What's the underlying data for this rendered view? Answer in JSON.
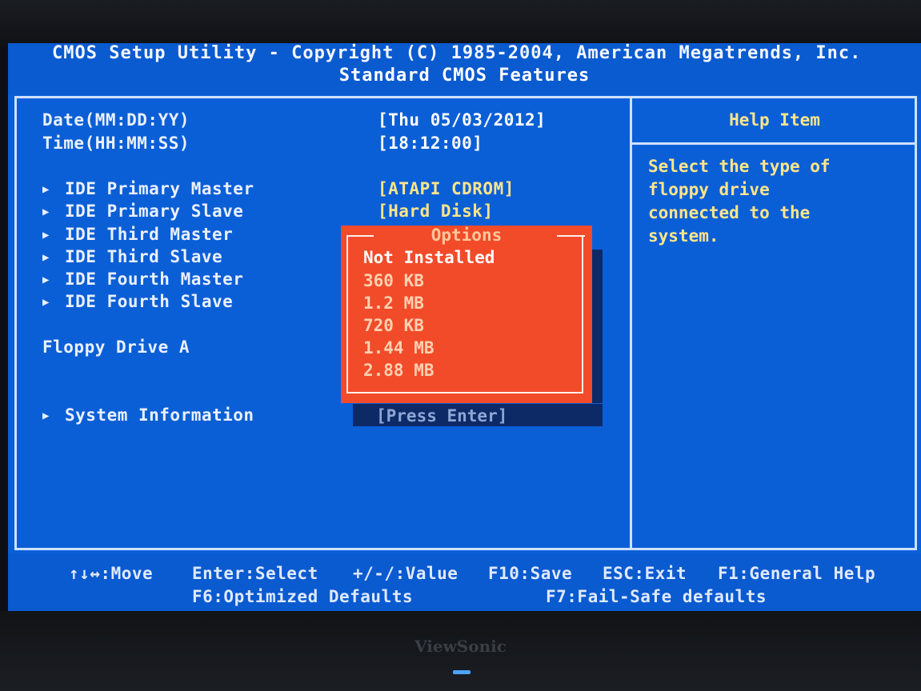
{
  "header": {
    "title": "CMOS Setup Utility - Copyright (C) 1985-2004, American Megatrends, Inc.",
    "subtitle": "Standard CMOS Features"
  },
  "settings": {
    "date": {
      "label": "Date(MM:DD:YY)",
      "value": "[Thu 05/03/2012]"
    },
    "time": {
      "label": "Time(HH:MM:SS)",
      "value": "[18:12:00]"
    },
    "ide": [
      {
        "label": "IDE Primary Master",
        "value": "[ATAPI CDROM]"
      },
      {
        "label": "IDE Primary Slave",
        "value": "[Hard Disk]"
      },
      {
        "label": "IDE Third Master",
        "value": ""
      },
      {
        "label": "IDE Third Slave",
        "value": ""
      },
      {
        "label": "IDE Fourth Master",
        "value": ""
      },
      {
        "label": "IDE Fourth Slave",
        "value": ""
      }
    ],
    "floppy": {
      "label": "Floppy Drive A"
    },
    "system_info": {
      "label": "System Information",
      "value": "[Press Enter]"
    }
  },
  "help": {
    "title": "Help Item",
    "text": "Select the type of\nfloppy drive\nconnected to the\nsystem."
  },
  "options_popup": {
    "title": "Options",
    "items": [
      "Not Installed",
      "360 KB",
      "1.2 MB",
      "720 KB",
      "1.44 MB",
      "2.88 MB"
    ],
    "selected": "Not Installed"
  },
  "footer": {
    "move": "↑↓↔:Move",
    "select": "Enter:Select",
    "value": "+/-/:Value",
    "save": "F10:Save",
    "exit": "ESC:Exit",
    "help": "F1:General Help",
    "optimized": "F6:Optimized Defaults",
    "failsafe": "F7:Fail-Safe defaults"
  },
  "monitor": {
    "brand": "ViewSonic"
  },
  "colors": {
    "background": "#0b5fd6",
    "popup": "#f24b2a",
    "help_text": "#ffe58a",
    "value_text": "#ffffff"
  }
}
